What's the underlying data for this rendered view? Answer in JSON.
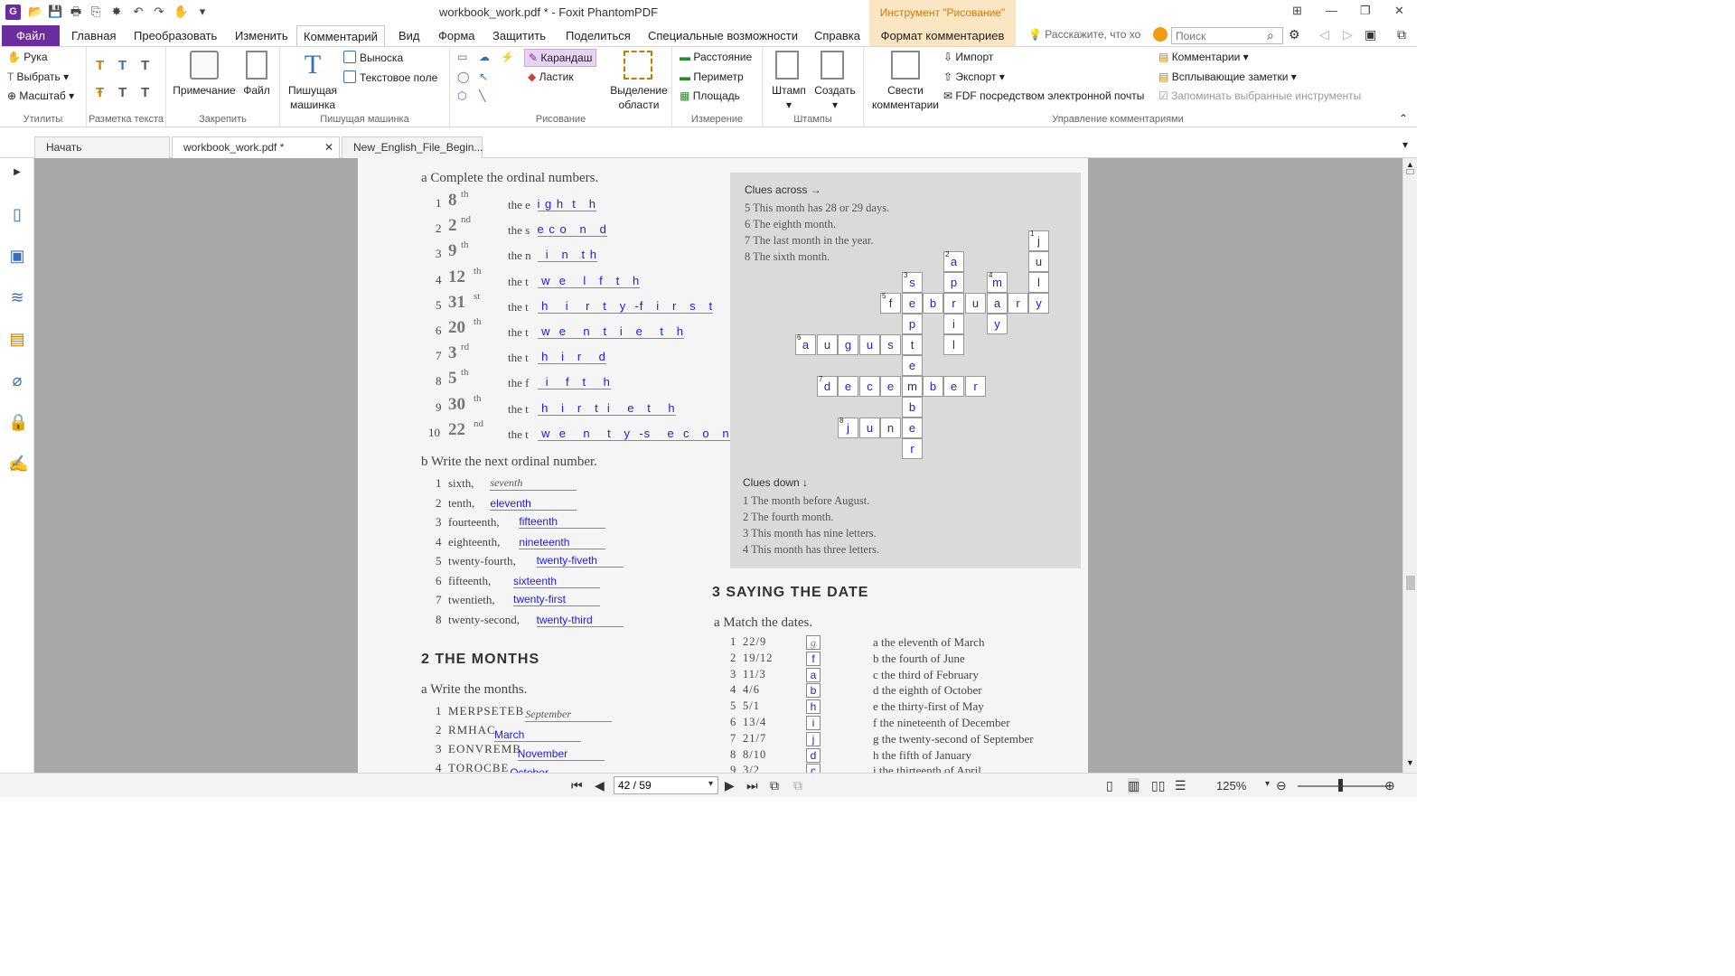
{
  "window": {
    "title": "workbook_work.pdf * - Foxit PhantomPDF",
    "draw_tool": "Инструмент \"Рисование\""
  },
  "menu_tabs": [
    "Файл",
    "Главная",
    "Преобразовать",
    "Изменить",
    "Комментарий",
    "Вид",
    "Форма",
    "Защитить",
    "Поделиться",
    "Специальные возможности",
    "Справка",
    "Формат комментариев"
  ],
  "tellme": "Расскажите, что хо",
  "search": {
    "placeholder": "Поиск"
  },
  "ribbon": {
    "utilities": {
      "label": "Утилиты",
      "hand": "Рука",
      "select": "Выбрать",
      "zoom": "Масштаб"
    },
    "markup": {
      "label": "Разметка текста"
    },
    "pin": {
      "label": "Закрепить",
      "note": "Примечание",
      "file": "Файл"
    },
    "typewriter": {
      "label": "Пишущая машинка",
      "big": "Пишущая машинка",
      "callout": "Выноска",
      "textbox": "Текстовое поле"
    },
    "drawing": {
      "label": "Рисование",
      "pencil": "Карандаш",
      "eraser": "Ластик",
      "area": "Выделение области"
    },
    "measure": {
      "label": "Измерение",
      "distance": "Расстояние",
      "perimeter": "Периметр",
      "area": "Площадь"
    },
    "stamps": {
      "label": "Штампы",
      "stamp": "Штамп",
      "create": "Создать"
    },
    "manage": {
      "label": "Управление комментариями",
      "summarize": "Свести комментарии",
      "import": "Импорт",
      "export": "Экспорт",
      "fdf": "FDF посредством электронной почты",
      "comments": "Комментарии",
      "popup": "Всплывающие заметки",
      "remember": "Запоминать выбранные инструменты"
    }
  },
  "doc_tabs": [
    "Начать",
    "workbook_work.pdf *",
    "New_English_File_Begin..."
  ],
  "page": {
    "ex_a": {
      "title": "a   Complete the ordinal numbers.",
      "rows": [
        {
          "n": "1",
          "num": "8",
          "sup": "th",
          "pre": "the e",
          "ans": "i g h  t   h"
        },
        {
          "n": "2",
          "num": "2",
          "sup": "nd",
          "pre": "the s",
          "ans": "e c o   n   d"
        },
        {
          "n": "3",
          "num": "9",
          "sup": "th",
          "pre": "the n",
          "ans": "  i   n   t h"
        },
        {
          "n": "4",
          "num": "12",
          "sup": "th",
          "pre": "the t",
          "ans": " w  e    l   f   t   h"
        },
        {
          "n": "5",
          "num": "31",
          "sup": "st",
          "pre": "the t",
          "ans": " h    i    r   t   y  -f   i   r   s   t"
        },
        {
          "n": "6",
          "num": "20",
          "sup": "th",
          "pre": "the t",
          "ans": " w  e    n   t   i   e    t   h"
        },
        {
          "n": "7",
          "num": "3",
          "sup": "rd",
          "pre": "the t",
          "ans": " h   i   r    d"
        },
        {
          "n": "8",
          "num": "5",
          "sup": "th",
          "pre": "the f",
          "ans": "  i    f   t    h"
        },
        {
          "n": "9",
          "num": "30",
          "sup": "th",
          "pre": "the t",
          "ans": " h   i   r   t  i    e   t    h"
        },
        {
          "n": "10",
          "num": "22",
          "sup": "nd",
          "pre": "the t",
          "ans": " w  e    n    t   y  -s    e  c   o   n    d"
        }
      ]
    },
    "ex_b": {
      "title": "b   Write the next ordinal number.",
      "rows": [
        {
          "n": "1",
          "q": "sixth,",
          "a": "seventh"
        },
        {
          "n": "2",
          "q": "tenth,",
          "a": "eleventh"
        },
        {
          "n": "3",
          "q": "fourteenth,",
          "a": "fifteenth"
        },
        {
          "n": "4",
          "q": "eighteenth,",
          "a": "nineteenth"
        },
        {
          "n": "5",
          "q": "twenty-fourth,",
          "a": "twenty-fiveth"
        },
        {
          "n": "6",
          "q": "fifteenth,",
          "a": "sixteenth"
        },
        {
          "n": "7",
          "q": "twentieth,",
          "a": "twenty-first"
        },
        {
          "n": "8",
          "q": "twenty-second,",
          "a": "twenty-third"
        }
      ]
    },
    "months": {
      "head": "2 THE MONTHS",
      "sub": "a   Write the months.",
      "rows": [
        {
          "n": "1",
          "q": "MERPSETEB",
          "a": "September"
        },
        {
          "n": "2",
          "q": "RMHAC",
          "a": "March"
        },
        {
          "n": "3",
          "q": "EONVREMB",
          "a": "November"
        },
        {
          "n": "4",
          "q": "TOROCBE",
          "a": "October"
        }
      ]
    },
    "clues_across": {
      "title": "Clues across →",
      "items": [
        "5  This month has 28 or 29 days.",
        "6  The eighth month.",
        "7  The last month in the year.",
        "8  The sixth month."
      ]
    },
    "clues_down": {
      "title": "Clues down ↓",
      "items": [
        "1  The month before August.",
        "2  The fourth month.",
        "3  This month has nine letters.",
        "4  This month has three letters."
      ]
    },
    "saying": {
      "head": "3 SAYING THE DATE",
      "sub": "a   Match the dates.",
      "rows": [
        {
          "n": "1",
          "d": "22/9",
          "a": "g",
          "r": "a  the eleventh of March"
        },
        {
          "n": "2",
          "d": "19/12",
          "a": "f",
          "r": "b  the fourth of June"
        },
        {
          "n": "3",
          "d": "11/3",
          "a": "a",
          "r": "c  the third of February"
        },
        {
          "n": "4",
          "d": "4/6",
          "a": "b",
          "r": "d  the eighth of October"
        },
        {
          "n": "5",
          "d": "5/1",
          "a": "h",
          "r": "e  the thirty-first of May"
        },
        {
          "n": "6",
          "d": "13/4",
          "a": "i",
          "r": "f  the nineteenth of December"
        },
        {
          "n": "7",
          "d": "21/7",
          "a": "j",
          "r": "g  the twenty-second of September"
        },
        {
          "n": "8",
          "d": "8/10",
          "a": "d",
          "r": "h  the fifth of January"
        },
        {
          "n": "9",
          "d": "3/2",
          "a": "c",
          "r": "i  the thirteenth of April"
        }
      ]
    },
    "crossword": [
      {
        "l": "j",
        "num": "1"
      },
      {
        "l": "u"
      },
      {
        "l": "l"
      },
      {
        "l": "y"
      },
      {
        "l": "a",
        "num": "2"
      },
      {
        "l": "p"
      },
      {
        "l": "r"
      },
      {
        "l": "i"
      },
      {
        "l": "l"
      },
      {
        "l": "s",
        "num": "3"
      },
      {
        "l": "p"
      },
      {
        "l": "t"
      },
      {
        "l": "e"
      },
      {
        "l": "m"
      },
      {
        "l": "b"
      },
      {
        "l": "e"
      },
      {
        "l": "r"
      },
      {
        "l": "m",
        "num": "4"
      },
      {
        "l": "a"
      },
      {
        "l": "y"
      },
      {
        "l": "f",
        "num": "5"
      },
      {
        "l": "e"
      },
      {
        "l": "b"
      },
      {
        "l": "u"
      },
      {
        "l": "r"
      },
      {
        "l": "a",
        "num": "6"
      },
      {
        "l": "u"
      },
      {
        "l": "g"
      },
      {
        "l": "u"
      },
      {
        "l": "s"
      },
      {
        "l": "d",
        "num": "7"
      },
      {
        "l": "e"
      },
      {
        "l": "c"
      },
      {
        "l": "e"
      },
      {
        "l": "e"
      },
      {
        "l": "r"
      },
      {
        "l": "j",
        "num": "8"
      },
      {
        "l": "u"
      },
      {
        "l": "n"
      }
    ]
  },
  "status": {
    "page": "42 / 59",
    "zoom": "125%"
  }
}
